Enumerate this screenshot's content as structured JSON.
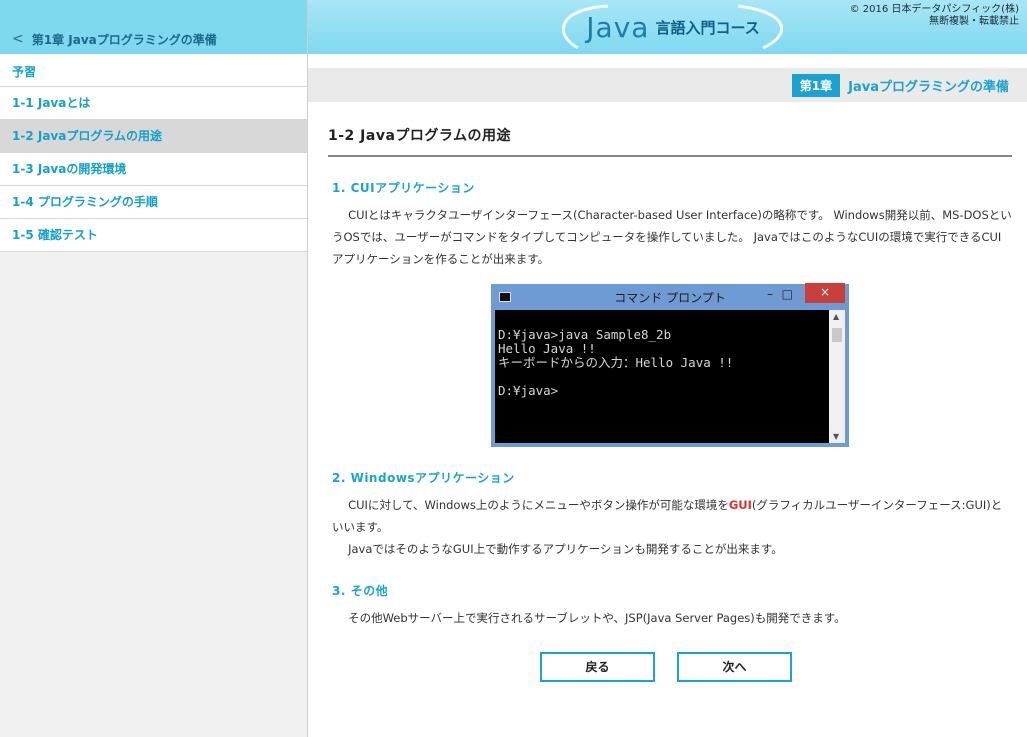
{
  "sidebar": {
    "back_chevron": "<",
    "chapter_link": "第1章 Javaプログラミングの準備",
    "items": [
      {
        "label": "予習"
      },
      {
        "label": "1-1  Javaとは"
      },
      {
        "label": "1-2  Javaプログラムの用途"
      },
      {
        "label": "1-3  Javaの開発環境"
      },
      {
        "label": "1-4  プログラミングの手順"
      },
      {
        "label": "1-5  確認テスト"
      }
    ],
    "active_index": 2
  },
  "header": {
    "logo_java": "Java",
    "logo_sub": "言語入門コース",
    "copyright_line1": "© 2016 日本データパシフィック(株)",
    "copyright_line2": "無断複製・転載禁止"
  },
  "chapter_bar": {
    "badge": "第1章",
    "title": "Javaプログラミングの準備"
  },
  "main": {
    "title": "1-2  Javaプログラムの用途",
    "sections": [
      {
        "heading": "1. CUIアプリケーション",
        "text": "CUIとはキャラクタユーザインターフェース(Character-based User Interface)の略称です。 Windows開発以前、MS-DOSというOSでは、ユーザーがコマンドをタイプしてコンピュータを操作していました。 JavaではこのようなCUIの環境で実行できるCUIアプリケーションを作ることが出来ます。"
      },
      {
        "heading": "2. Windowsアプリケーション",
        "text_before": "CUIに対して、Windows上のようにメニューやボタン操作が可能な環境を",
        "text_highlight": "GUI",
        "text_after": "(グラフィカルユーザーインターフェース:GUI)といいます。",
        "text2": "JavaではそのようなGUI上で動作するアプリケーションも開発することが出来ます。"
      },
      {
        "heading": "3. その他",
        "text": "その他Webサーバー上で実行されるサーブレットや、JSP(Java Server Pages)も開発できます。"
      }
    ]
  },
  "console": {
    "title": "コマンド プロンプト",
    "minimize": "–",
    "maximize": "□",
    "close": "×",
    "lines": "D:¥java>java Sample8_2b\nHello Java !!\nキーボードからの入力：Hello Java !!\n\nD:¥java>"
  },
  "buttons": {
    "back": "戻る",
    "next": "次へ"
  },
  "colors": {
    "accent": "#1aa3d0",
    "header_bg": "#7ed8ee",
    "highlight": "#e23030"
  }
}
